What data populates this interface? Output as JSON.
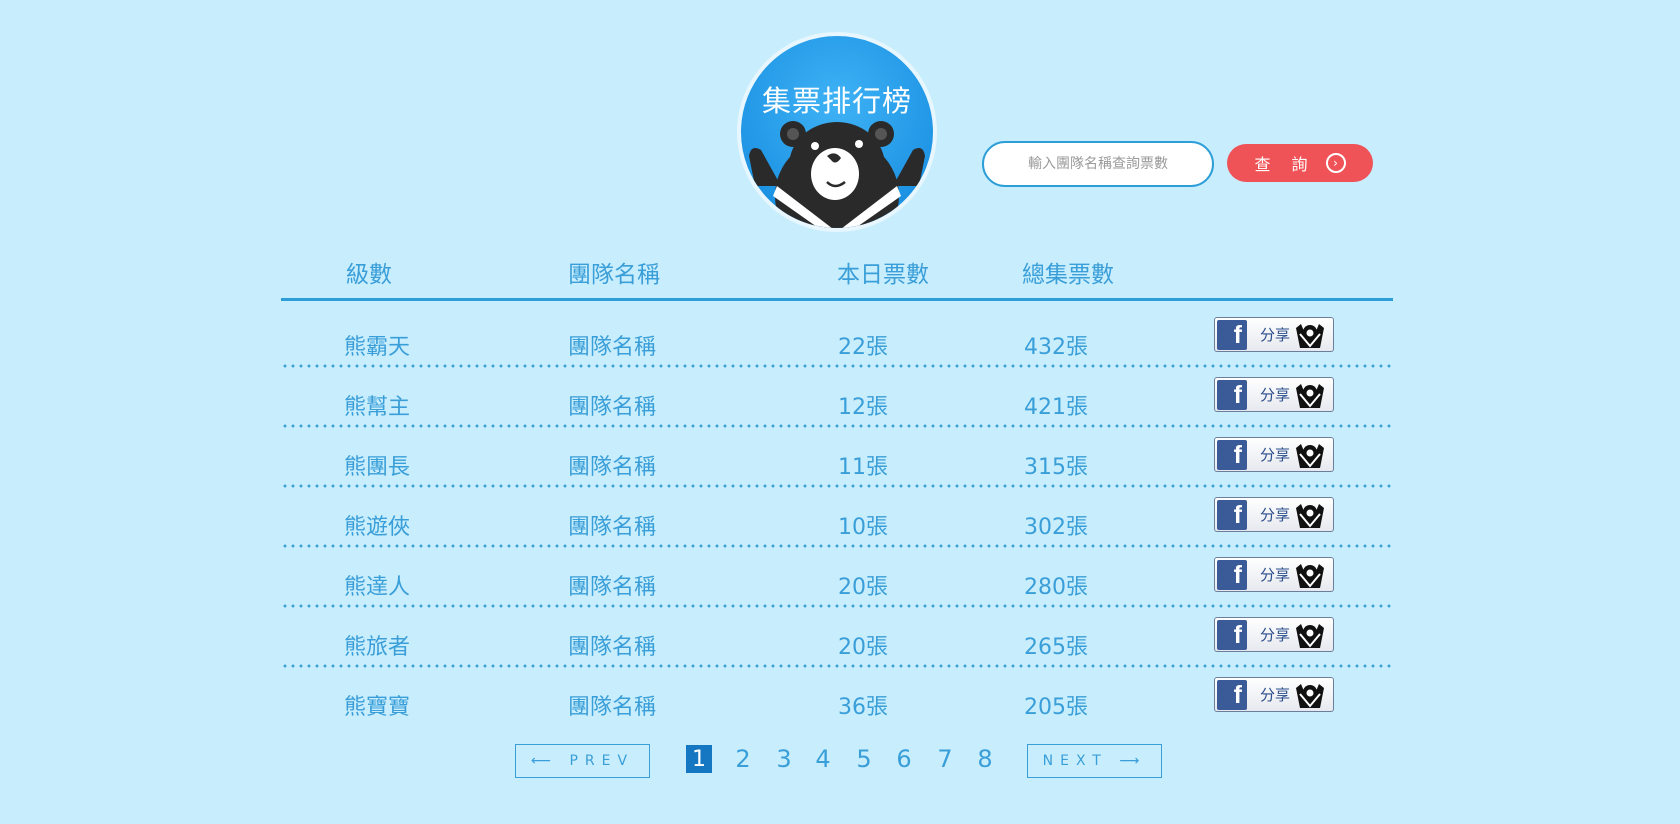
{
  "badge": {
    "title": "集票排行榜"
  },
  "search": {
    "placeholder": "輸入團隊名稱查詢票數",
    "button_label": "查 詢",
    "button_icon": "arrow-right-circle-icon"
  },
  "table": {
    "headers": [
      "級數",
      "團隊名稱",
      "本日票數",
      "總集票數"
    ],
    "rows": [
      {
        "level": "熊霸天",
        "team": "團隊名稱",
        "today": "22張",
        "total": "432張",
        "share": "分享"
      },
      {
        "level": "熊幫主",
        "team": "團隊名稱",
        "today": "12張",
        "total": "421張",
        "share": "分享"
      },
      {
        "level": "熊團長",
        "team": "團隊名稱",
        "today": "11張",
        "total": "315張",
        "share": "分享"
      },
      {
        "level": "熊遊俠",
        "team": "團隊名稱",
        "today": "10張",
        "total": "302張",
        "share": "分享"
      },
      {
        "level": "熊達人",
        "team": "團隊名稱",
        "today": "20張",
        "total": "280張",
        "share": "分享"
      },
      {
        "level": "熊旅者",
        "team": "團隊名稱",
        "today": "20張",
        "total": "265張",
        "share": "分享"
      },
      {
        "level": "熊寶寶",
        "team": "團隊名稱",
        "today": "36張",
        "total": "205張",
        "share": "分享"
      }
    ]
  },
  "pagination": {
    "prev": "⟵ PREV",
    "next": "NEXT ⟶",
    "pages": [
      "1",
      "2",
      "3",
      "4",
      "5",
      "6",
      "7",
      "8"
    ],
    "current": "1"
  },
  "colors": {
    "background": "#c8eefe",
    "accent": "#3a9ed8",
    "search_button": "#ef5357",
    "active_page": "#1576c1",
    "facebook": "#3b5b98"
  }
}
